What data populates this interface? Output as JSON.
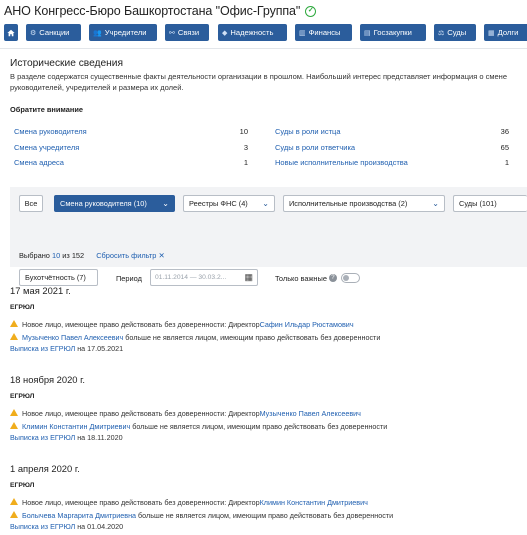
{
  "page": {
    "title": "АНО Конгресс-Бюро Башкортостана \"Офис-Группа\"",
    "verified_icon": "check-circle-icon",
    "verified_color": "#2faa3f"
  },
  "nav": {
    "home_icon": "home-icon",
    "items": [
      {
        "label": "Санкции",
        "icon": "gear-icon"
      },
      {
        "label": "Учредители",
        "icon": "users-icon"
      },
      {
        "label": "Связи",
        "icon": "link-icon"
      },
      {
        "label": "Надежность",
        "icon": "shield-icon"
      },
      {
        "label": "Финансы",
        "icon": "finance-icon"
      },
      {
        "label": "Госзакупки",
        "icon": "cart-icon"
      },
      {
        "label": "Суды",
        "icon": "gavel-icon"
      },
      {
        "label": "Долги",
        "icon": "debt-icon"
      }
    ],
    "accent": "#2b5d9c"
  },
  "history": {
    "title": "Исторические сведения",
    "description": "В разделе содержатся существенные факты деятельности организации в прошлом. Наибольший интерес представляет информация о смене руководителей, учредителей и размера их долей.",
    "attention": "Обратите внимание",
    "stats_left": [
      {
        "label": "Смена руководителя",
        "count": "10"
      },
      {
        "label": "Смена учредителя",
        "count": "3"
      },
      {
        "label": "Смена адреса",
        "count": "1"
      }
    ],
    "stats_right": [
      {
        "label": "Суды в роли истца",
        "count": "36"
      },
      {
        "label": "Суды в роли ответчика",
        "count": "65"
      },
      {
        "label": "Новые исполнительные производства",
        "count": "1"
      }
    ]
  },
  "filters": {
    "all": "Все",
    "change_head": "Смена руководителя (10)",
    "registers": "Реестры ФНС (4)",
    "enforcement": "Исполнительные производства (2)",
    "courts": "Суды (101)",
    "accounting": "Бухотчётность (7)",
    "period_label": "Период",
    "period_value": "01.11.2014 — 30.03.2...",
    "only_important": "Только важные",
    "selected_prefix": "Выбрано",
    "selected_count": "10",
    "selected_of": "из 152",
    "reset": "Сбросить фильтр"
  },
  "events": [
    {
      "date": "17 мая 2021 г.",
      "source": "ЕГРЮЛ",
      "lines": [
        {
          "prefix": "Новое лицо, имеющее право действовать без доверенности: Директор ",
          "name": "Сафин Ильдар Рюстамович",
          "suffix": ""
        },
        {
          "prefix": "",
          "name": "Музыченко Павел Алексеевич",
          "suffix": " больше не является лицом, имеющим право действовать без доверенности"
        }
      ],
      "extract_link": "Выписка из ЕГРЮЛ",
      "extract_date": "на 17.05.2021"
    },
    {
      "date": "18 ноября 2020 г.",
      "source": "ЕГРЮЛ",
      "lines": [
        {
          "prefix": "Новое лицо, имеющее право действовать без доверенности: Директор ",
          "name": "Музыченко Павел Алексеевич",
          "suffix": ""
        },
        {
          "prefix": "",
          "name": "Климин Константин Дмитриевич",
          "suffix": " больше не является лицом, имеющим право действовать без доверенности"
        }
      ],
      "extract_link": "Выписка из ЕГРЮЛ",
      "extract_date": "на 18.11.2020"
    },
    {
      "date": "1 апреля 2020 г.",
      "source": "ЕГРЮЛ",
      "lines": [
        {
          "prefix": "Новое лицо, имеющее право действовать без доверенности: Директор ",
          "name": "Климин Константин Дмитриевич",
          "suffix": ""
        },
        {
          "prefix": "",
          "name": "Болычева Маргарита Дмитриевна",
          "suffix": " больше не является лицом, имеющим право действовать без доверенности"
        }
      ],
      "extract_link": "Выписка из ЕГРЮЛ",
      "extract_date": "на 01.04.2020"
    }
  ]
}
